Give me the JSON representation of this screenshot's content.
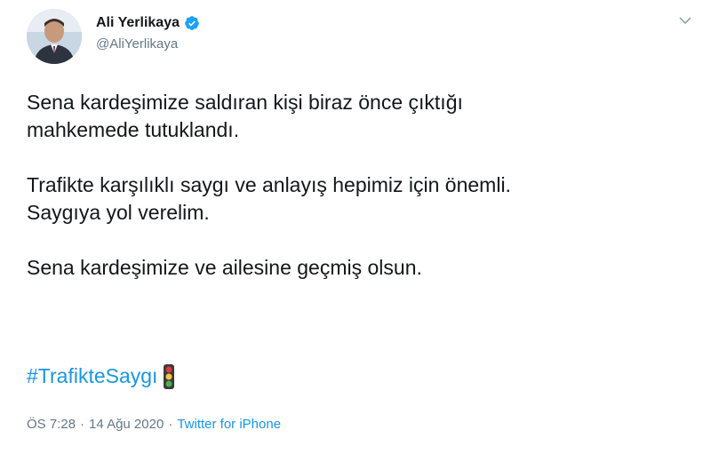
{
  "author": {
    "display_name": "Ali Yerlikaya",
    "handle": "@AliYerlikaya",
    "verified": true
  },
  "tweet": {
    "paragraphs": [
      [
        "Sena kardeşimize saldıran kişi biraz önce çıktığı",
        "mahkemede tutuklandı."
      ],
      [
        "Trafikte karşılıklı saygı ve anlayış hepimiz için önemli.",
        "Saygıya yol verelim."
      ],
      [
        "Sena kardeşimize ve ailesine geçmiş olsun."
      ]
    ],
    "hashtag": "#TrafikteSaygı",
    "emoji": "traffic-light-icon"
  },
  "meta": {
    "time": "ÖS 7:28",
    "separator": "·",
    "date": "14 Ağu 2020",
    "source": "Twitter for iPhone"
  },
  "colors": {
    "link": "#1b95e0",
    "muted": "#657786",
    "text": "#14171a",
    "verified_badge": "#1da1f2"
  }
}
